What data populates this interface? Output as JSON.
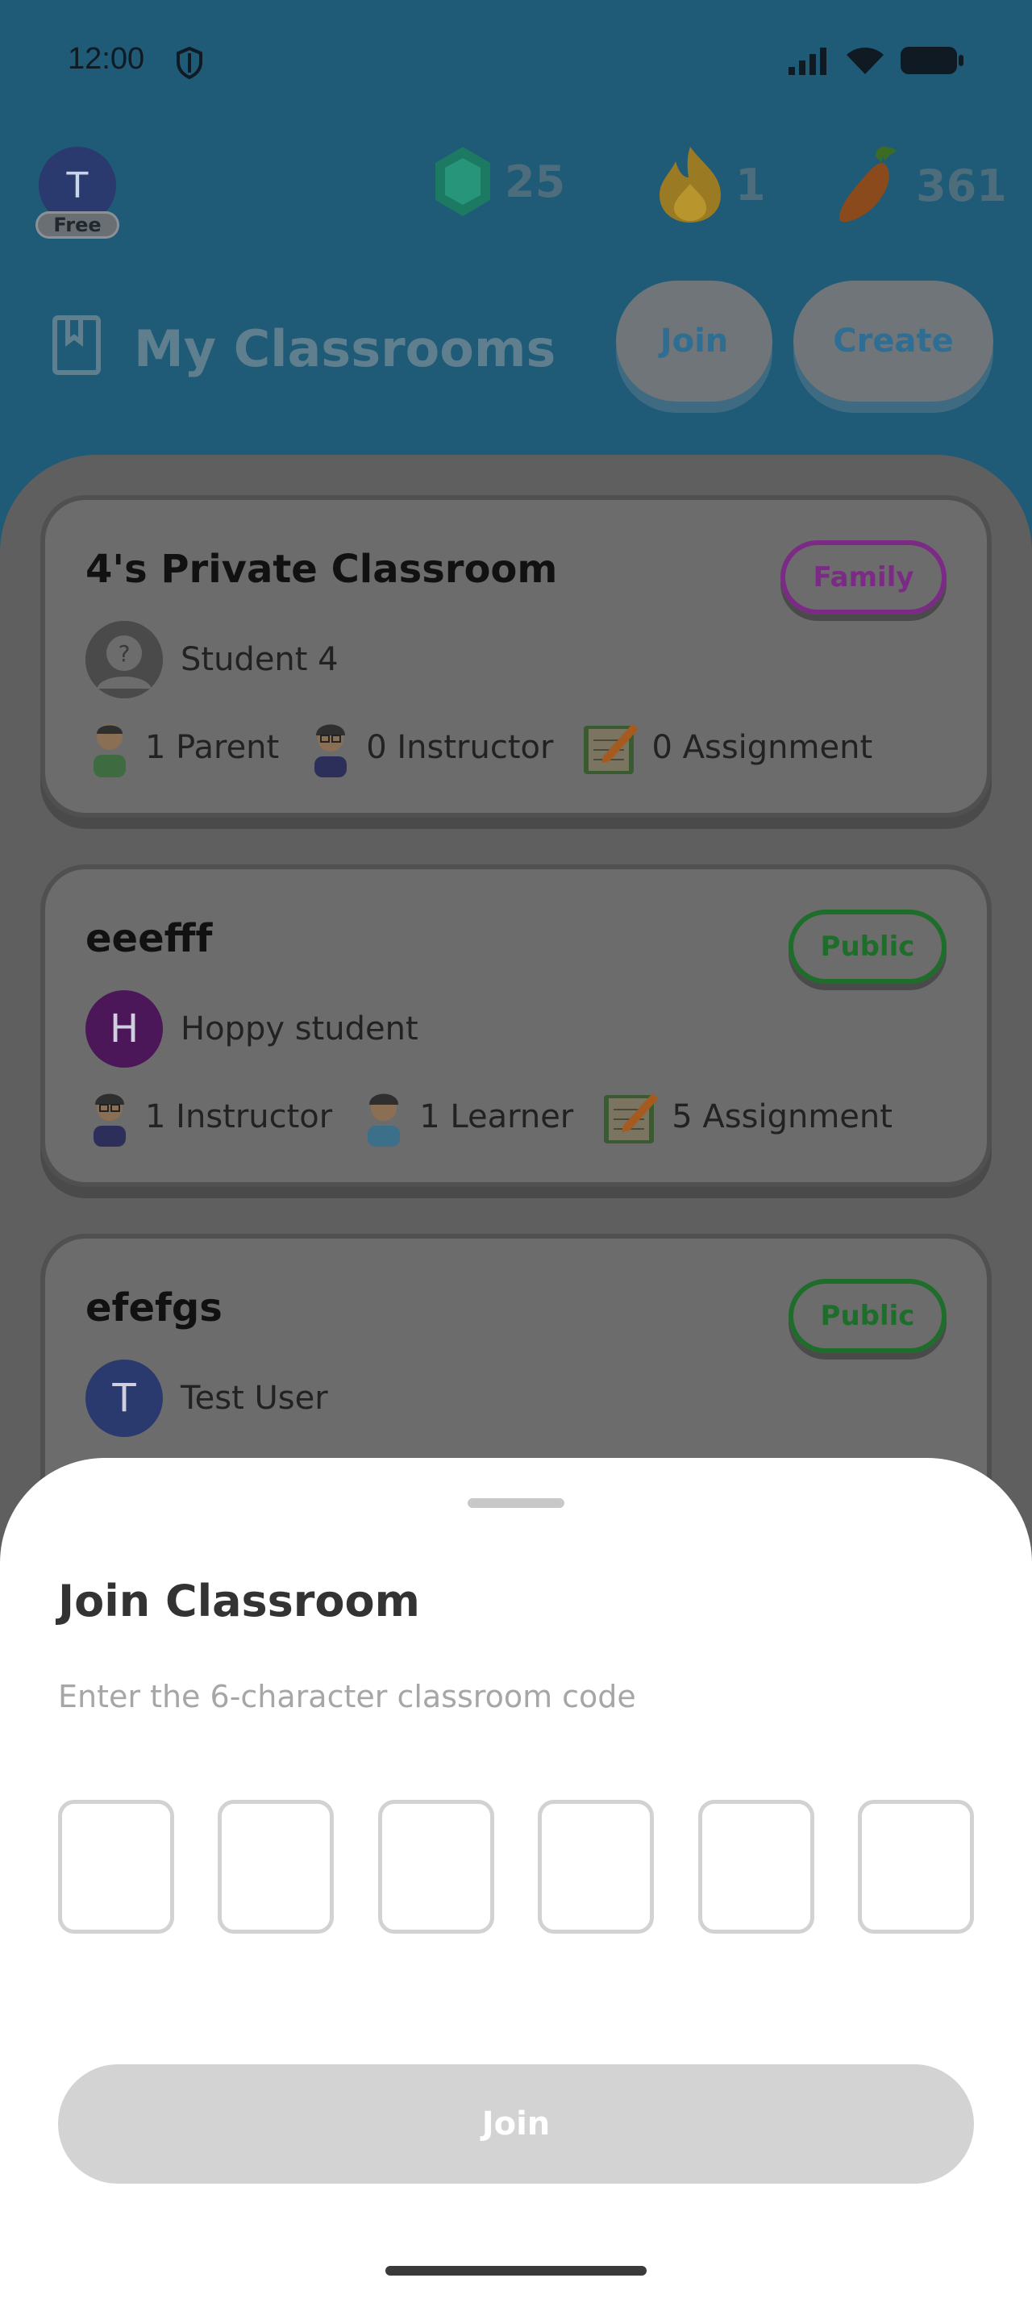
{
  "status_bar": {
    "time": "12:00"
  },
  "profile": {
    "initial": "T",
    "plan": "Free",
    "avatar_color": "#2a3a6e"
  },
  "stats": {
    "gems": "25",
    "streak": "1",
    "carrots": "361"
  },
  "header": {
    "title": "My Classrooms",
    "join_label": "Join",
    "create_label": "Create"
  },
  "classrooms": [
    {
      "name": "4's Private Classroom",
      "badge": "Family",
      "badge_color": "#7b2a86",
      "owner_initial": "?",
      "owner_name": "Student 4",
      "meta": [
        "1 Parent",
        "0 Instructor",
        "0 Assignment"
      ]
    },
    {
      "name": "eeefff",
      "badge": "Public",
      "badge_color": "#1f6d2b",
      "owner_initial": "H",
      "owner_name": "Hoppy student",
      "meta": [
        "1 Instructor",
        "1 Learner",
        "5 Assignment"
      ]
    },
    {
      "name": "efefgs",
      "badge": "Public",
      "badge_color": "#1f6d2b",
      "owner_initial": "T",
      "owner_name": "Test User",
      "meta": []
    }
  ],
  "join_sheet": {
    "title": "Join Classroom",
    "subtitle": "Enter the 6-character classroom code",
    "submit_label": "Join"
  },
  "colors": {
    "header_bg": "#1f5a77",
    "overlay_card": "#6c6c6c",
    "submit_disabled": "#d3d3d3"
  }
}
